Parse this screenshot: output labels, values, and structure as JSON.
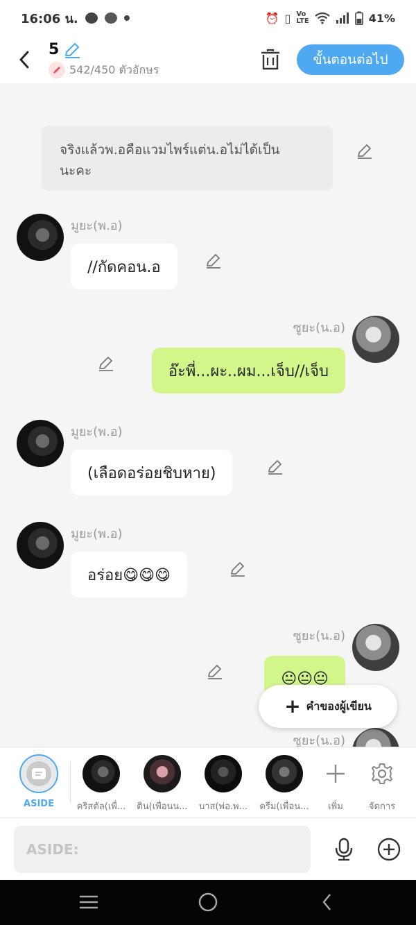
{
  "status_bar": {
    "time": "16:06 น.",
    "battery": "41%",
    "icons": [
      "chat-bubble-icon",
      "messenger-icon",
      "dot-icon",
      "alarm-icon",
      "vibrate-icon",
      "volte-icon",
      "wifi-icon",
      "signal-icon",
      "battery-icon"
    ]
  },
  "header": {
    "episode": "5",
    "char_count": "542/450 ตัวอักษร",
    "next_label": "ขั้นตอนต่อไป"
  },
  "chat": {
    "narration": "จริงแล้วพ.อคือแวมไพร์แต่น.อไม่ได้เป็น นะคะ",
    "messages": [
      {
        "speaker": "มูยะ(พ.อ)",
        "text": "//กัดคอน.อ",
        "side": "left"
      },
      {
        "speaker": "ซูยะ(น.อ)",
        "text": "อ๊ะพี่...ผะ..ผม...เจ็บ//เจ็บ",
        "side": "right"
      },
      {
        "speaker": "มูยะ(พ.อ)",
        "text": "(เลือดอร่อยชิบหาย)",
        "side": "left"
      },
      {
        "speaker": "มูยะ(พ.อ)",
        "text": "อร่อย😋😋😋",
        "side": "left"
      },
      {
        "speaker": "ซูยะ(น.อ)",
        "text": "😐😐😐",
        "side": "right"
      },
      {
        "speaker": "ซูยะ(น.อ)",
        "text": "",
        "side": "right"
      }
    ]
  },
  "fab": {
    "label": "คำของผู้เขียน"
  },
  "characters": [
    {
      "label": "ASIDE",
      "type": "aside"
    },
    {
      "label": "คริสตัล(เพื่...",
      "type": "photo"
    },
    {
      "label": "ติน(เพื่อนน...",
      "type": "photo"
    },
    {
      "label": "บาส(พ่อ.พ...",
      "type": "photo"
    },
    {
      "label": "ดรีม(เพื่อน...",
      "type": "photo"
    },
    {
      "label": "เพิ่ม",
      "type": "add"
    },
    {
      "label": "จัดการ",
      "type": "manage"
    }
  ],
  "input": {
    "placeholder": "ASIDE:",
    "value": ""
  },
  "colors": {
    "accent": "#4ea9f0",
    "right_bubble": "#d3f68a",
    "narration_bg": "#ececec"
  }
}
